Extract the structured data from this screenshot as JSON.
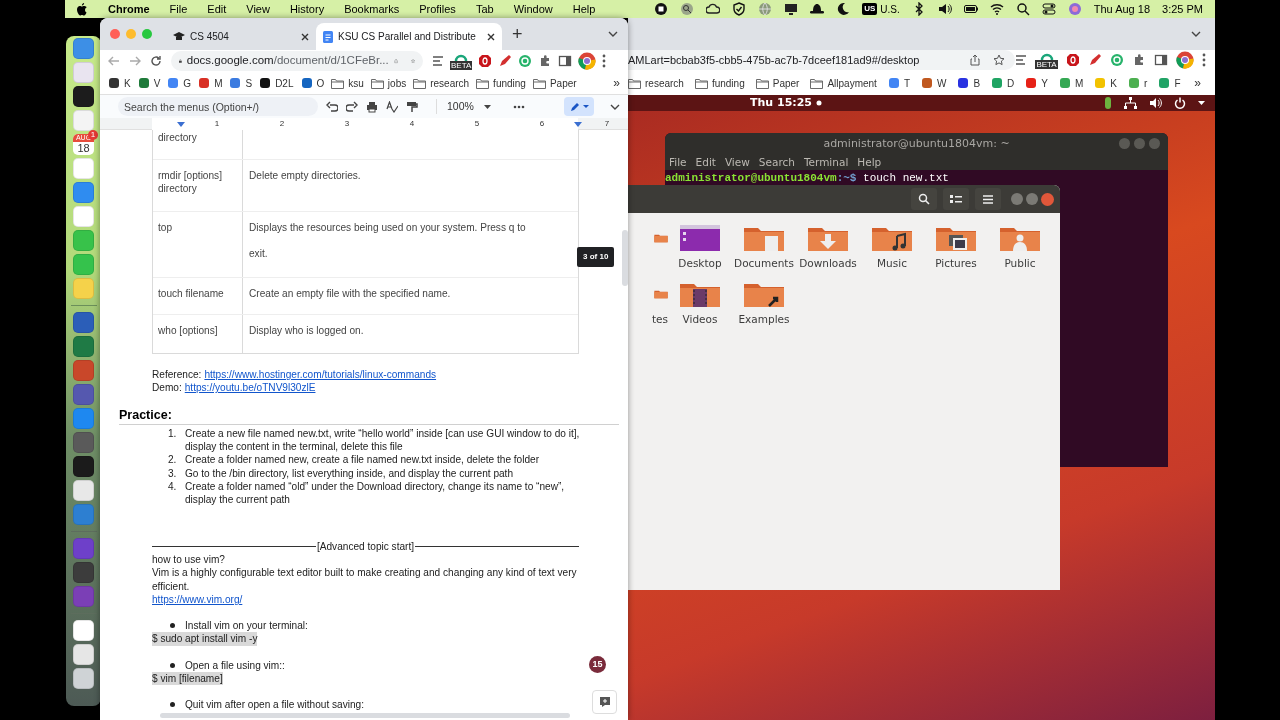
{
  "menu_bar": {
    "app": "Chrome",
    "items": [
      "File",
      "Edit",
      "View",
      "History",
      "Bookmarks",
      "Profiles",
      "Tab",
      "Window",
      "Help"
    ],
    "keyboard": "US",
    "input_source": "U.S.",
    "date": "Thu Aug 18",
    "time": "3:25 PM"
  },
  "dock": {
    "apps": [
      {
        "kind": "app",
        "color": "#3d8fe6"
      },
      {
        "kind": "app",
        "color": "#e9e4f0"
      },
      {
        "kind": "app",
        "color": "#1c1c1c"
      },
      {
        "kind": "app",
        "color": "#f4f4f4"
      },
      {
        "kind": "calendar",
        "color": "#ffffff"
      },
      {
        "kind": "app",
        "color": "#ffffff"
      },
      {
        "kind": "app",
        "color": "#2f8cf0"
      },
      {
        "kind": "app",
        "color": "#ffffff"
      },
      {
        "kind": "app",
        "color": "#38c24a"
      },
      {
        "kind": "app",
        "color": "#35c24c"
      },
      {
        "kind": "app",
        "color": "#f5d24a"
      },
      {
        "kind": "separator",
        "color": "#6b8f5a"
      },
      {
        "kind": "app",
        "color": "#2b5eb8"
      },
      {
        "kind": "app",
        "color": "#1f7a45"
      },
      {
        "kind": "app",
        "color": "#c9472a"
      },
      {
        "kind": "app",
        "color": "#5558af"
      },
      {
        "kind": "app",
        "color": "#1e88f0"
      },
      {
        "kind": "app",
        "color": "#5a5a5a"
      },
      {
        "kind": "app",
        "color": "#1b1b1b"
      },
      {
        "kind": "app",
        "color": "#e8e8e8"
      },
      {
        "kind": "app",
        "color": "#2d7fd1"
      },
      {
        "kind": "separator",
        "color": "#5d6d5d"
      },
      {
        "kind": "app",
        "color": "#6e40c9"
      },
      {
        "kind": "app",
        "color": "#3c3c3c"
      },
      {
        "kind": "app",
        "color": "#7b3fb6"
      },
      {
        "kind": "separator",
        "color": "#5d6d5d"
      },
      {
        "kind": "app",
        "color": "#ffffff"
      },
      {
        "kind": "app",
        "color": "#e6e6e6"
      },
      {
        "kind": "app",
        "color": "#cfd3d6"
      }
    ],
    "calendar_month": "AUG",
    "calendar_day": "18",
    "calendar_badge": "1"
  },
  "browser": {
    "tabs": [
      {
        "label": "CS 4504",
        "selected": false
      },
      {
        "label": "KSU CS Parallel and Distribute",
        "selected": true
      }
    ],
    "new_tab": "+",
    "url_host": "docs.google.com",
    "url_path": "/document/d/1CFeBr...",
    "beta_badge": "BETA",
    "bookmarks": [
      {
        "label": "K",
        "kind": "app",
        "color": "#333333"
      },
      {
        "label": "V",
        "kind": "app",
        "color": "#1f7a3a"
      },
      {
        "label": "G",
        "kind": "app",
        "color": "#4285f4"
      },
      {
        "label": "M",
        "kind": "app",
        "color": "#d93025"
      },
      {
        "label": "S",
        "kind": "app",
        "color": "#3b7be0"
      },
      {
        "label": "D2L",
        "kind": "app",
        "color": "#111111"
      },
      {
        "label": "O",
        "kind": "app",
        "color": "#1565c0"
      },
      {
        "label": "ksu",
        "kind": "folder",
        "color": "#6b6b6b"
      },
      {
        "label": "jobs",
        "kind": "folder",
        "color": "#6b6b6b"
      },
      {
        "label": "research",
        "kind": "folder",
        "color": "#6b6b6b"
      },
      {
        "label": "funding",
        "kind": "folder",
        "color": "#6b6b6b"
      },
      {
        "label": "Paper",
        "kind": "folder",
        "color": "#6b6b6b"
      }
    ],
    "more": "»"
  },
  "docs_toolbar": {
    "search_placeholder": "Search the menus (Option+/)",
    "zoom": "100%"
  },
  "ruler": [
    "1",
    "2",
    "3",
    "4",
    "5",
    "6",
    "7"
  ],
  "table": {
    "rows": [
      {
        "command": "directory",
        "description": []
      },
      {
        "command": "rmdir [options] directory",
        "description": [
          "Delete empty directories."
        ]
      },
      {
        "command": "top",
        "description": [
          "Displays the resources being used on your system. Press q to",
          "exit."
        ]
      },
      {
        "command": "touch filename",
        "description": [
          "Create an empty file with the specified name."
        ]
      },
      {
        "command": "who [options]",
        "description": [
          "Display who is logged on."
        ]
      }
    ]
  },
  "page_indicator": "3 of 10",
  "references": [
    {
      "label": "Reference:",
      "link": "https://www.hostinger.com/tutorials/linux-commands"
    },
    {
      "label": "Demo:",
      "link": "https://youtu.be/oTNV9l30zlE"
    }
  ],
  "practice": {
    "heading": "Practice:",
    "items": [
      {
        "number": "1.",
        "text": "Create a new file named new.txt, write “hello world” inside [can use GUI window to do it], display the content in the terminal, delete this file"
      },
      {
        "number": "2.",
        "text": "Create a folder named new, create a file named new.txt inside, delete the folder"
      },
      {
        "number": "3.",
        "text": "Go to the /bin directory, list everything inside, and display the current path"
      },
      {
        "number": "4.",
        "text": "Create a folder named “old” under the Download directory, change its name to “new”, display the current path"
      }
    ]
  },
  "advanced_divider": "[Advanced topic start]",
  "vim": {
    "title": "how to use vim?",
    "description": "Vim is a highly configurable text editor built to make creating and changing any kind of text very efficient.",
    "link": "https://www.vim.org/",
    "steps": [
      {
        "bullet": "Install vim on your terminal:",
        "code": "$ sudo apt install vim -y"
      },
      {
        "bullet": "Open a file using vim::",
        "code": "$ vim [filename]"
      },
      {
        "bullet": "Quit vim after open a file without saving:"
      }
    ]
  },
  "comments_badge": "15",
  "back_browser": {
    "url": "AMLart=bcbab3f5-cbb5-475b-ac7b-7dceef181ad9#/desktop",
    "beta_badge": "BETA",
    "bookmarks": [
      {
        "label": "research",
        "kind": "folder",
        "color": "#6b6b6b"
      },
      {
        "label": "funding",
        "kind": "folder",
        "color": "#6b6b6b"
      },
      {
        "label": "Paper",
        "kind": "folder",
        "color": "#6b6b6b"
      },
      {
        "label": "Allpayment",
        "kind": "folder",
        "color": "#6b6b6b"
      },
      {
        "label": "T",
        "kind": "app",
        "color": "#4285f4"
      },
      {
        "label": "W",
        "kind": "app",
        "color": "#c0581f"
      },
      {
        "label": "B",
        "kind": "app",
        "color": "#2932e1"
      },
      {
        "label": "D",
        "kind": "app",
        "color": "#1fa463"
      },
      {
        "label": "Y",
        "kind": "app",
        "color": "#e62117"
      },
      {
        "label": "M",
        "kind": "app",
        "color": "#34a853"
      },
      {
        "label": "K",
        "kind": "app",
        "color": "#f2c200"
      },
      {
        "label": "r",
        "kind": "app",
        "color": "#4caf50"
      },
      {
        "label": "F",
        "kind": "app",
        "color": "#21a366"
      }
    ],
    "more": "»"
  },
  "ubuntu": {
    "clock": "Thu 15:25"
  },
  "terminal": {
    "title": "administrator@ubuntu1804vm: ~",
    "menu": [
      "File",
      "Edit",
      "View",
      "Search",
      "Terminal",
      "Help"
    ],
    "prompt_user": "administrator@ubuntu1804vm",
    "prompt_path": ":~$",
    "command": "touch new.txt"
  },
  "files": {
    "items": [
      {
        "kind": "folder"
      },
      {
        "label": "Desktop",
        "kind": "desktop"
      },
      {
        "label": "Documents",
        "kind": "documents"
      },
      {
        "label": "Downloads",
        "kind": "downloads"
      },
      {
        "label": "Music",
        "kind": "music"
      },
      {
        "label": "Pictures",
        "kind": "pictures"
      },
      {
        "label": "Public",
        "kind": "public"
      },
      {
        "label": "tes",
        "kind": "folder"
      },
      {
        "label": "Videos",
        "kind": "videos"
      },
      {
        "label": "Examples",
        "kind": "examples"
      }
    ]
  }
}
